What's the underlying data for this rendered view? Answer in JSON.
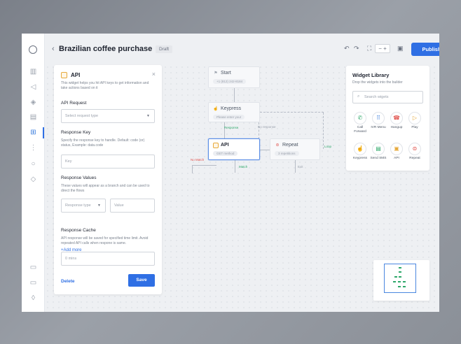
{
  "header": {
    "title": "Brazilian coffee purchase",
    "status_badge": "Draft",
    "publish_label": "Publish",
    "zoom_symbol": "−",
    "zoom_plus": "+"
  },
  "panel": {
    "title": "API",
    "description": "This widget helps you hit API keys to get information and take actions based on it",
    "api_request": {
      "label": "API Request",
      "placeholder": "Select request type"
    },
    "response_key": {
      "label": "Response Key",
      "description": "Specify the response key to handle. Default: code (or) status, Example: data.code",
      "placeholder": "Key"
    },
    "response_values": {
      "label": "Response Values",
      "description": "These values will appear as a branch and can be used to direct the flows",
      "type_placeholder": "Response type",
      "value_placeholder": "Value",
      "add_more": "+Add more"
    },
    "response_cache": {
      "label": "Response Cache",
      "description": "API response will be saved for specified time limit. Avoid repeated API calls when respone is same.",
      "placeholder": "0 mins"
    },
    "delete_label": "Delete",
    "save_label": "Save"
  },
  "flow": {
    "start": {
      "title": "Start",
      "badge": "+1 (812) 242-8184"
    },
    "keypress": {
      "title": "Keypress",
      "badge": "Please enter your"
    },
    "api": {
      "title": "API",
      "badge": "GET method"
    },
    "repeat": {
      "title": "Repeat",
      "badge": "3 repetitions"
    },
    "edges": {
      "response": "Response",
      "no_response": "No response",
      "no_match": "No Match",
      "match": "Match",
      "exit": "Exit",
      "loop": "Loop"
    }
  },
  "library": {
    "title": "Widget Library",
    "subtitle": "Drop the widgets into the builder",
    "search_placeholder": "Search wigets",
    "widgets": [
      {
        "label": "Call Forward",
        "icon": "phone-forward-icon",
        "color": "#2ea86a"
      },
      {
        "label": "IVR Menu",
        "icon": "keypad-icon",
        "color": "#3b7ddd"
      },
      {
        "label": "Hangup",
        "icon": "hangup-icon",
        "color": "#e0524d"
      },
      {
        "label": "Play",
        "icon": "play-icon",
        "color": "#e6a93b"
      },
      {
        "label": "Keypress",
        "icon": "keypress-icon",
        "color": "#3b7ddd"
      },
      {
        "label": "Send SMS",
        "icon": "sms-icon",
        "color": "#2ea86a"
      },
      {
        "label": "API",
        "icon": "api-icon",
        "color": "#e6a93b"
      },
      {
        "label": "Repeat",
        "icon": "repeat-icon",
        "color": "#e0524d"
      }
    ]
  },
  "colors": {
    "accent": "#2f6fe4",
    "match_green": "#2ea86a",
    "no_match_red": "#e0524d"
  }
}
